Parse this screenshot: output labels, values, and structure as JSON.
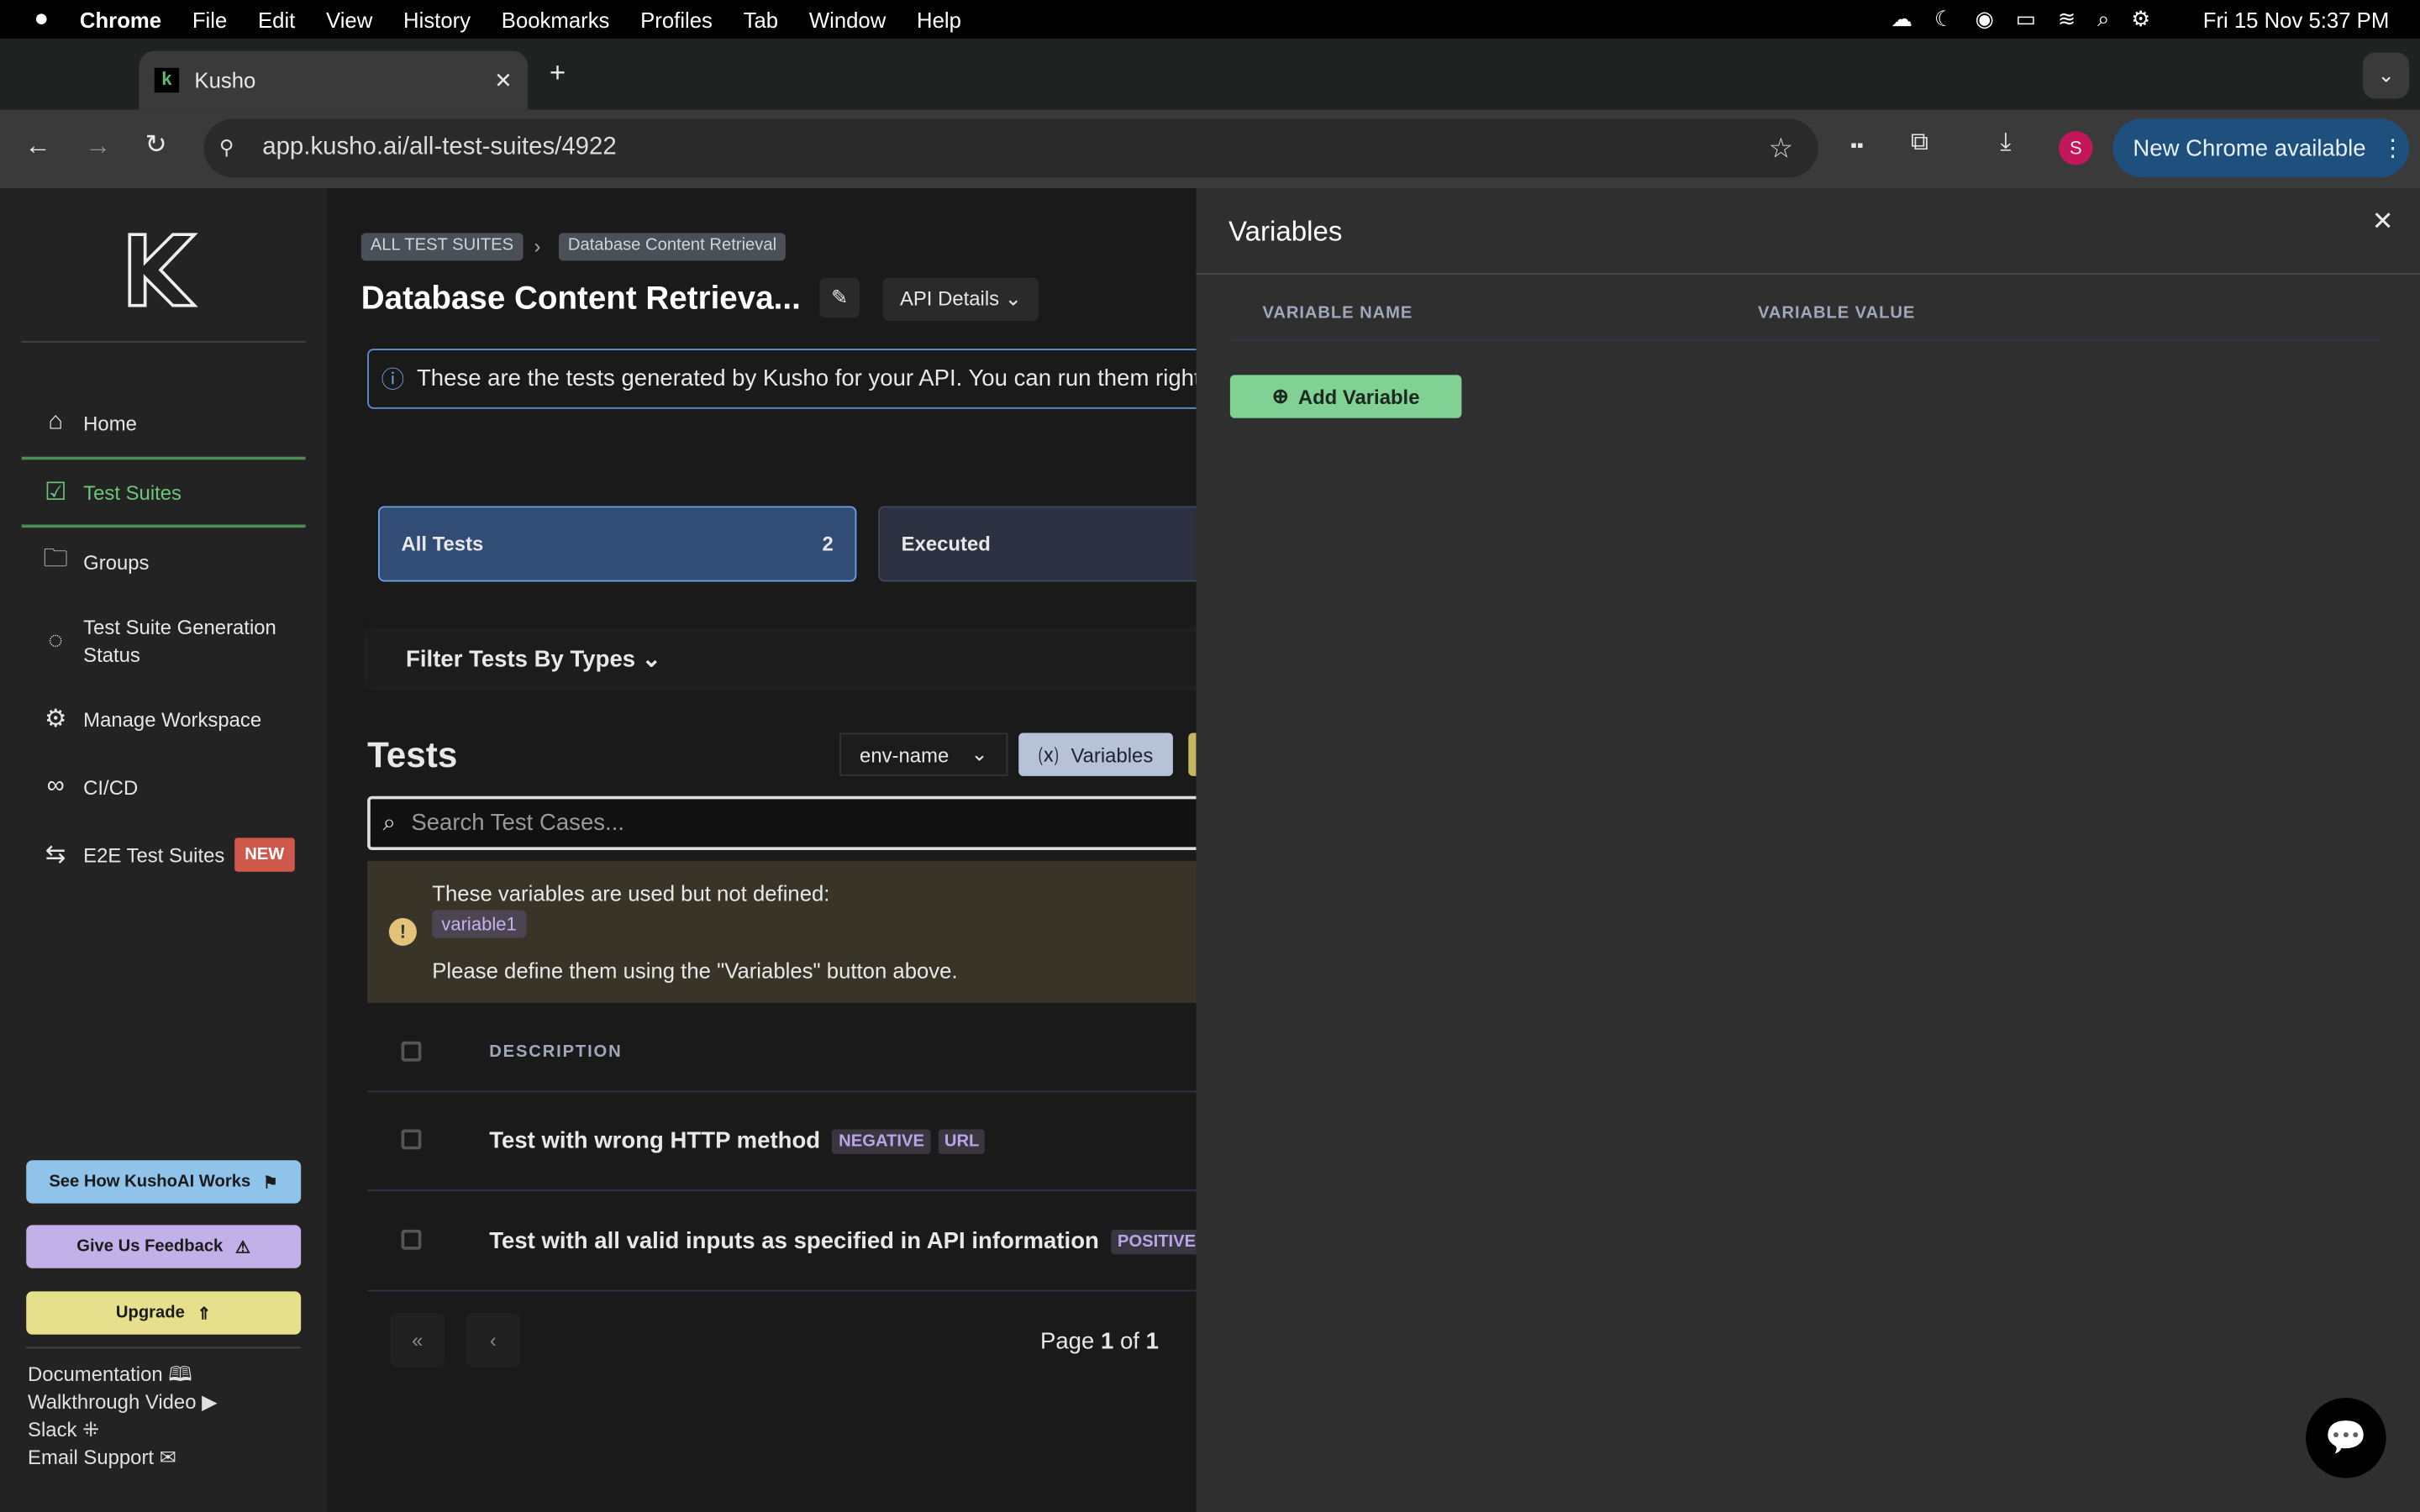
{
  "menubar": {
    "apple": "",
    "items": [
      "Chrome",
      "File",
      "Edit",
      "View",
      "History",
      "Bookmarks",
      "Profiles",
      "Tab",
      "Window",
      "Help"
    ],
    "clock": "Fri 15 Nov  5:37 PM"
  },
  "browser": {
    "tab_title": "Kusho",
    "tab_favicon": "k",
    "url": "app.kusho.ai/all-test-suites/4922",
    "profile_initial": "S",
    "update_label": "New Chrome available"
  },
  "sidebar": {
    "items": [
      {
        "label": "Home",
        "icon": "home-icon"
      },
      {
        "label": "Test Suites",
        "icon": "checklist-icon"
      },
      {
        "label": "Groups",
        "icon": "folder-icon"
      },
      {
        "label": "Test Suite Generation Status",
        "icon": "status-icon"
      },
      {
        "label": "Manage Workspace",
        "icon": "gear-icon"
      },
      {
        "label": "CI/CD",
        "icon": "infinity-icon"
      },
      {
        "label": "E2E Test Suites",
        "icon": "swap-icon",
        "badge": "NEW"
      }
    ],
    "buttons": {
      "how": "See How KushoAI Works",
      "feedback": "Give Us Feedback",
      "upgrade": "Upgrade"
    },
    "links": [
      "Documentation",
      "Walkthrough Video",
      "Slack",
      "Email Support"
    ],
    "accent": "#5fb870"
  },
  "main": {
    "breadcrumb": [
      "ALL TEST SUITES",
      "Database Content Retrieval"
    ],
    "title": "Database Content Retrieva...",
    "api_details": "API Details",
    "info": "These are the tests generated by Kusho for your API. You can run them right",
    "tabs": [
      {
        "label": "All Tests",
        "count": "2"
      },
      {
        "label": "Executed"
      }
    ],
    "filter": "Filter Tests By Types",
    "tests_heading": "Tests",
    "env": "env-name",
    "variables_btn": "Variables",
    "search_placeholder": "Search Test Cases...",
    "warning": {
      "line1": "These variables are used but not defined:",
      "variable": "variable1",
      "line2": "Please define them using the \"Variables\" button above."
    },
    "table": {
      "header": "DESCRIPTION",
      "rows": [
        {
          "description": "Test with wrong HTTP method",
          "tags": [
            "NEGATIVE",
            "URL"
          ]
        },
        {
          "description": "Test with all valid inputs as specified in API information",
          "tags": [
            "POSITIVE"
          ]
        }
      ]
    },
    "pagination": {
      "page_label": "Page",
      "current": "1",
      "of": "of",
      "total": "1"
    }
  },
  "panel": {
    "title": "Variables",
    "col_name": "VARIABLE NAME",
    "col_value": "VARIABLE VALUE",
    "add_label": "Add Variable"
  }
}
